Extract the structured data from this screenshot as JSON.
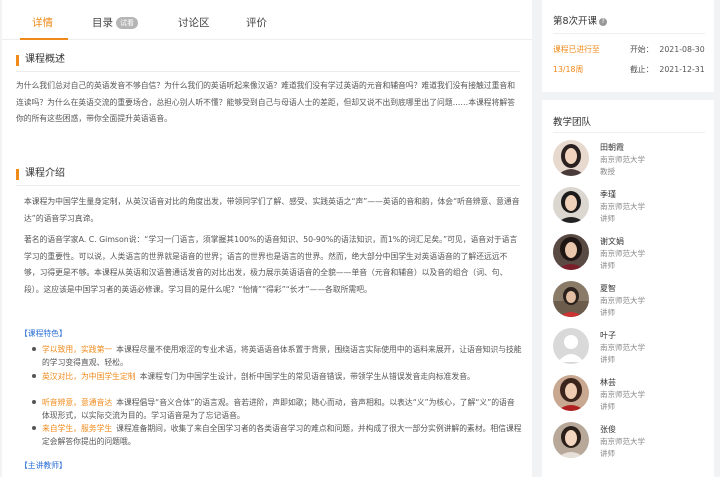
{
  "tabs": [
    {
      "label": "详情",
      "active": true
    },
    {
      "label": "目录",
      "badge": "试看"
    },
    {
      "label": "讨论区"
    },
    {
      "label": "评价"
    }
  ],
  "overview": {
    "title": "课程概述",
    "text": "为什么我们总对自己的英语发音不够自信？为什么我们的英语听起来像汉语？难道我们没有学过英语的元音和辅音吗？难道我们没有接触过重音和连读吗？为什么在英语交流的重要场合，总担心别人听不懂？能够受到自己与母语人士的差距，但却又说不出到底哪里出了问题……本课程将解答你的所有这些困惑，带你全面提升英语语音。"
  },
  "intro": {
    "title": "课程介绍",
    "p1": "本课程为中国学生量身定制，从英汉语音对比的角度出发，带领同学们了解、感受、实践英语之“声”——英语的音和韵，体会“听音辨意、意通音达”的语音学习真谛。",
    "p2": "著名的语音学家A. C. Gimson说：“学习一门语言，须掌握其100%的语音知识、50-90%的语法知识，而1%的词汇足矣。”可见，语音对于语言学习的重要性。可以说，人类语言的世界就是语音的世界；语言的世界也是语言的世界。然而，绝大部分中国学生对英语语音的了解还远远不够，习得更是不够。本课程从英语和汉语普通话发音的对比出发，极力展示英语语音的全貌——单音（元音和辅音）以及音的组合（词、句、段）。这应该是中国学习者的英语必修课。学习目的是什么呢？“怡情”“得彩”“长才”——各取所需吧。",
    "features_title": "【课程特色】",
    "features": [
      {
        "highlight": "学以致用，实践第一",
        "text": "本课程尽量不使用艰涩的专业术语，将英语语音体系置于背景，围绕语言实际使用中的语料来展开，让语音知识与技能的学习变得直观、轻松。"
      },
      {
        "highlight": "英汉对比，为中国学生定制",
        "text": "本课程专门为中国学生设计，剖析中国学生的常见语音错误，带领学生从错误发音走向标准发音。"
      },
      {
        "highlight": "听音辨意，意通音达",
        "text": "本课程倡导“音义合体”的语言观。音若进阶，声即如歌；随心而动，音声相和。以表达“义”为核心，了解“义”的语音体现形式，以实际交流为目的。学习语音是为了忘记语音。"
      },
      {
        "highlight": "来自学生，服务学生",
        "text": "课程准备期间，收集了来自全国学习者的各类语音学习的难点和问题，并构成了很大一部分实例讲解的素材。相信课程定会解答你提出的问题哦。"
      }
    ],
    "teacher_title": "【主讲教师】"
  },
  "session": {
    "title": "第8次开课",
    "help_icon": "question-icon",
    "status": "课程已进行至",
    "progress": "13/18周",
    "start_label": "开始：",
    "start_date": "2021-08-30",
    "end_label": "截止：",
    "end_date": "2021-12-31"
  },
  "team": {
    "title": "教学团队",
    "members": [
      {
        "name": "田朝霞",
        "org": "南京师范大学",
        "title": "教授"
      },
      {
        "name": "季瑾",
        "org": "南京师范大学",
        "title": "讲师"
      },
      {
        "name": "谢文娟",
        "org": "南京师范大学",
        "title": "讲师"
      },
      {
        "name": "夏智",
        "org": "南京师范大学",
        "title": "讲师"
      },
      {
        "name": "叶子",
        "org": "南京师范大学",
        "title": "讲师"
      },
      {
        "name": "林芸",
        "org": "南京师范大学",
        "title": "讲师"
      },
      {
        "name": "张俊",
        "org": "南京师范大学",
        "title": "讲师"
      }
    ]
  },
  "colors": {
    "accent": "#f08a1a",
    "link": "#2a6fd6"
  }
}
